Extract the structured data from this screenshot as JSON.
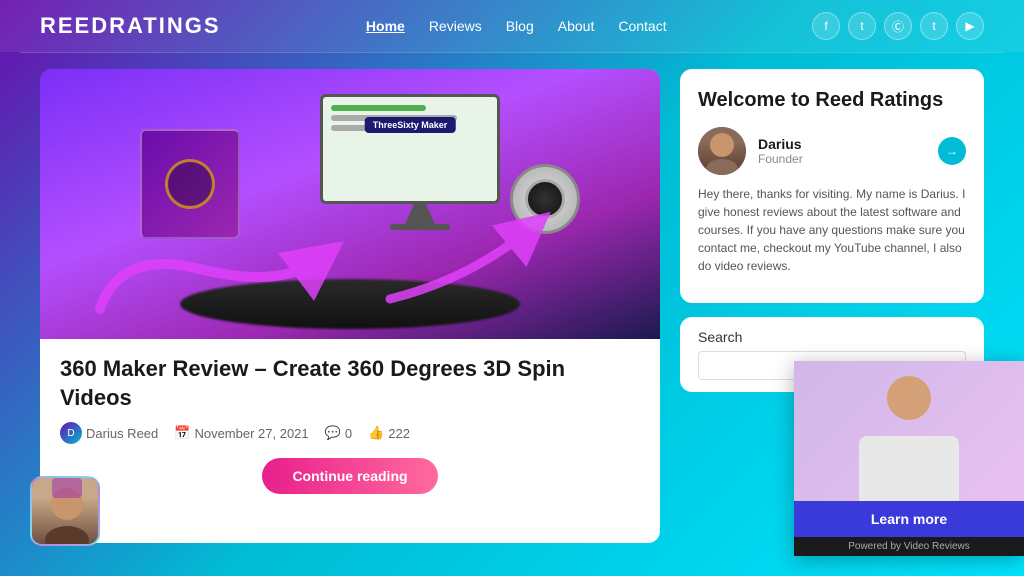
{
  "header": {
    "logo": "ReedRatings",
    "nav": {
      "items": [
        {
          "label": "Home",
          "active": true
        },
        {
          "label": "Reviews",
          "active": false
        },
        {
          "label": "Blog",
          "active": false
        },
        {
          "label": "About",
          "active": false
        },
        {
          "label": "Contact",
          "active": false
        }
      ]
    },
    "social": [
      "f",
      "t",
      "𝐩",
      "t",
      "▶"
    ]
  },
  "article": {
    "image_alt": "360 Maker product image with camera and monitor",
    "title": "360 Maker Review – Create 360 Degrees 3D Spin Videos",
    "meta": {
      "author": "Darius Reed",
      "date": "November 27, 2021",
      "comments": "0",
      "likes": "222"
    },
    "continue_btn": "Continue reading"
  },
  "sidebar": {
    "welcome_title": "Welcome to Reed Ratings",
    "author": {
      "name": "Darius",
      "role": "Founder"
    },
    "bio_text": "Hey there, thanks for visiting. My name is Darius. I give honest reviews about the latest software and courses. If you have any questions make sure you contact me, checkout my YouTube channel, I also do video reviews.",
    "search": {
      "label": "Search",
      "placeholder": ""
    }
  },
  "video_widget": {
    "learn_more_label": "Learn more",
    "powered_by": "Powered by Video Reviews"
  },
  "threesixty_label": "ThreeSixty Maker"
}
